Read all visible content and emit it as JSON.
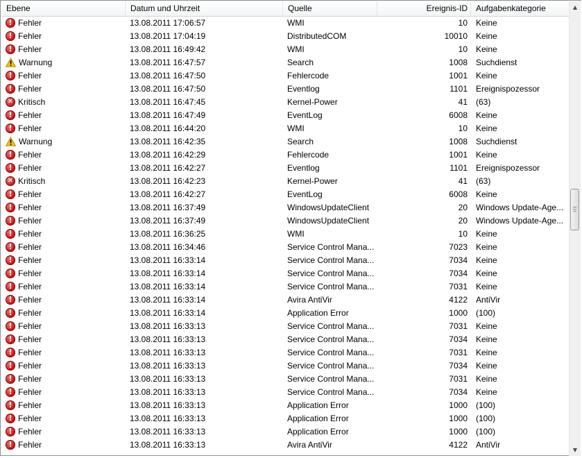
{
  "columns": {
    "level": "Ebene",
    "date": "Datum und Uhrzeit",
    "source": "Quelle",
    "id": "Ereignis-ID",
    "category": "Aufgabenkategorie"
  },
  "level_icons": {
    "Fehler": "error-icon",
    "Warnung": "warning-icon",
    "Kritisch": "critical-icon"
  },
  "colors": {
    "error": "#c10d0d",
    "warning": "#f5c400",
    "critical": "#b51818"
  },
  "events": [
    {
      "level": "Fehler",
      "date": "13.08.2011 17:06:57",
      "source": "WMI",
      "id": "10",
      "category": "Keine"
    },
    {
      "level": "Fehler",
      "date": "13.08.2011 17:04:19",
      "source": "DistributedCOM",
      "id": "10010",
      "category": "Keine"
    },
    {
      "level": "Fehler",
      "date": "13.08.2011 16:49:42",
      "source": "WMI",
      "id": "10",
      "category": "Keine"
    },
    {
      "level": "Warnung",
      "date": "13.08.2011 16:47:57",
      "source": "Search",
      "id": "1008",
      "category": "Suchdienst"
    },
    {
      "level": "Fehler",
      "date": "13.08.2011 16:47:50",
      "source": "Fehlercode",
      "id": "1001",
      "category": "Keine"
    },
    {
      "level": "Fehler",
      "date": "13.08.2011 16:47:50",
      "source": "Eventlog",
      "id": "1101",
      "category": "Ereignispozessor"
    },
    {
      "level": "Kritisch",
      "date": "13.08.2011 16:47:45",
      "source": "Kernel-Power",
      "id": "41",
      "category": "(63)"
    },
    {
      "level": "Fehler",
      "date": "13.08.2011 16:47:49",
      "source": "EventLog",
      "id": "6008",
      "category": "Keine"
    },
    {
      "level": "Fehler",
      "date": "13.08.2011 16:44:20",
      "source": "WMI",
      "id": "10",
      "category": "Keine"
    },
    {
      "level": "Warnung",
      "date": "13.08.2011 16:42:35",
      "source": "Search",
      "id": "1008",
      "category": "Suchdienst"
    },
    {
      "level": "Fehler",
      "date": "13.08.2011 16:42:29",
      "source": "Fehlercode",
      "id": "1001",
      "category": "Keine"
    },
    {
      "level": "Fehler",
      "date": "13.08.2011 16:42:27",
      "source": "Eventlog",
      "id": "1101",
      "category": "Ereignispozessor"
    },
    {
      "level": "Kritisch",
      "date": "13.08.2011 16:42:23",
      "source": "Kernel-Power",
      "id": "41",
      "category": "(63)"
    },
    {
      "level": "Fehler",
      "date": "13.08.2011 16:42:27",
      "source": "EventLog",
      "id": "6008",
      "category": "Keine"
    },
    {
      "level": "Fehler",
      "date": "13.08.2011 16:37:49",
      "source": "WindowsUpdateClient",
      "id": "20",
      "category": "Windows Update-Age..."
    },
    {
      "level": "Fehler",
      "date": "13.08.2011 16:37:49",
      "source": "WindowsUpdateClient",
      "id": "20",
      "category": "Windows Update-Age..."
    },
    {
      "level": "Fehler",
      "date": "13.08.2011 16:36:25",
      "source": "WMI",
      "id": "10",
      "category": "Keine"
    },
    {
      "level": "Fehler",
      "date": "13.08.2011 16:34:46",
      "source": "Service Control Mana...",
      "id": "7023",
      "category": "Keine"
    },
    {
      "level": "Fehler",
      "date": "13.08.2011 16:33:14",
      "source": "Service Control Mana...",
      "id": "7034",
      "category": "Keine"
    },
    {
      "level": "Fehler",
      "date": "13.08.2011 16:33:14",
      "source": "Service Control Mana...",
      "id": "7034",
      "category": "Keine"
    },
    {
      "level": "Fehler",
      "date": "13.08.2011 16:33:14",
      "source": "Service Control Mana...",
      "id": "7031",
      "category": "Keine"
    },
    {
      "level": "Fehler",
      "date": "13.08.2011 16:33:14",
      "source": "Avira AntiVir",
      "id": "4122",
      "category": "AntiVir"
    },
    {
      "level": "Fehler",
      "date": "13.08.2011 16:33:14",
      "source": "Application Error",
      "id": "1000",
      "category": "(100)"
    },
    {
      "level": "Fehler",
      "date": "13.08.2011 16:33:13",
      "source": "Service Control Mana...",
      "id": "7031",
      "category": "Keine"
    },
    {
      "level": "Fehler",
      "date": "13.08.2011 16:33:13",
      "source": "Service Control Mana...",
      "id": "7034",
      "category": "Keine"
    },
    {
      "level": "Fehler",
      "date": "13.08.2011 16:33:13",
      "source": "Service Control Mana...",
      "id": "7031",
      "category": "Keine"
    },
    {
      "level": "Fehler",
      "date": "13.08.2011 16:33:13",
      "source": "Service Control Mana...",
      "id": "7034",
      "category": "Keine"
    },
    {
      "level": "Fehler",
      "date": "13.08.2011 16:33:13",
      "source": "Service Control Mana...",
      "id": "7031",
      "category": "Keine"
    },
    {
      "level": "Fehler",
      "date": "13.08.2011 16:33:13",
      "source": "Service Control Mana...",
      "id": "7034",
      "category": "Keine"
    },
    {
      "level": "Fehler",
      "date": "13.08.2011 16:33:13",
      "source": "Application Error",
      "id": "1000",
      "category": "(100)"
    },
    {
      "level": "Fehler",
      "date": "13.08.2011 16:33:13",
      "source": "Application Error",
      "id": "1000",
      "category": "(100)"
    },
    {
      "level": "Fehler",
      "date": "13.08.2011 16:33:13",
      "source": "Application Error",
      "id": "1000",
      "category": "(100)"
    },
    {
      "level": "Fehler",
      "date": "13.08.2011 16:33:13",
      "source": "Avira AntiVir",
      "id": "4122",
      "category": "AntiVir"
    }
  ]
}
